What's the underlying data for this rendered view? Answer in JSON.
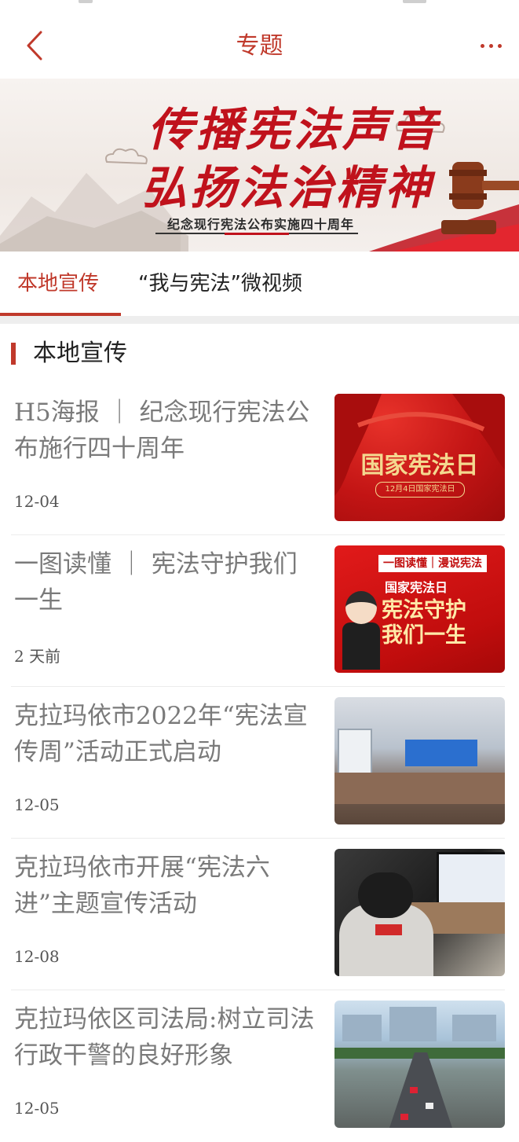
{
  "header": {
    "title": "专题"
  },
  "banner": {
    "line1": "传播宪法声音",
    "line2": "弘扬法治精神",
    "subtitle": "纪念现行宪法公布实施四十周年"
  },
  "tabs": [
    {
      "label": "本地宣传",
      "active": true
    },
    {
      "label": "“我与宪法”微视频",
      "active": false
    }
  ],
  "section": {
    "title": "本地宣传"
  },
  "articles": [
    {
      "title": "H5海报 ｜ 纪念现行宪法公布施行四十周年",
      "date": "12-04",
      "thumb": {
        "headline": "国家宪法日",
        "caption": "12月4日国家宪法日"
      }
    },
    {
      "title": "一图读懂 ｜ 宪法守护我们一生",
      "date": "2 天前",
      "thumb": {
        "tag": "一图读懂｜漫说宪法",
        "line1": "国家宪法日",
        "line2": "宪法守护",
        "line3": "我们一生"
      }
    },
    {
      "title": "克拉玛依市2022年“宪法宣传周”活动正式启动",
      "date": "12-05"
    },
    {
      "title": "克拉玛依市开展“宪法六进”主题宣传活动",
      "date": "12-08"
    },
    {
      "title": "克拉玛依区司法局:树立司法行政干警的良好形象",
      "date": "12-05"
    }
  ],
  "colors": {
    "accent": "#c0392b",
    "title_gray": "#7a7a7a"
  },
  "icons": {
    "back": "chevron-left-icon",
    "more": "more-dots-icon"
  }
}
